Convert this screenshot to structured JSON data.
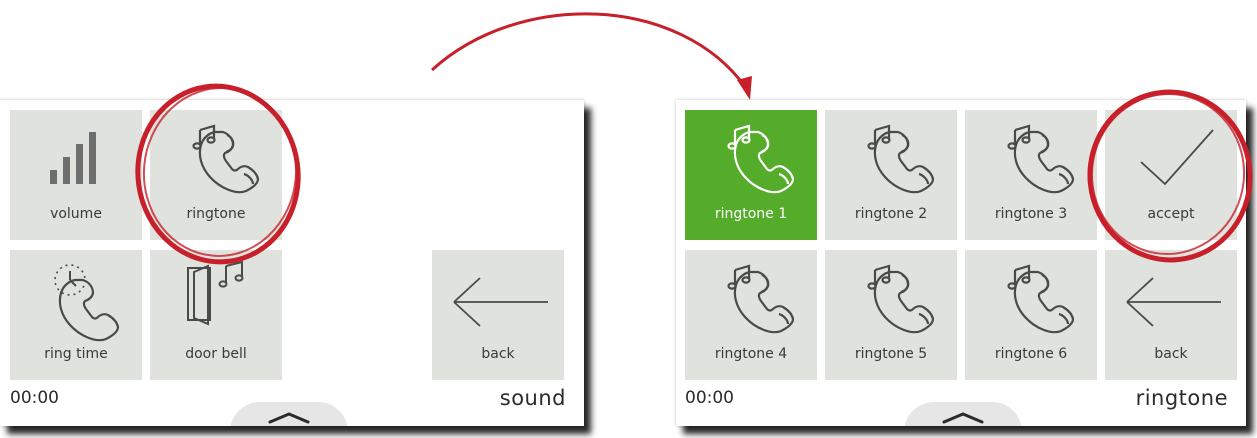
{
  "left_screen": {
    "tiles": [
      {
        "label": "volume",
        "icon": "volume-bars-icon"
      },
      {
        "label": "ringtone",
        "icon": "phone-music-icon"
      },
      {
        "label": "ring time",
        "icon": "phone-clock-icon"
      },
      {
        "label": "door bell",
        "icon": "door-music-icon"
      },
      {
        "label": "back",
        "icon": "back-arrow-icon"
      }
    ],
    "clock": "00:00",
    "title": "sound"
  },
  "right_screen": {
    "tiles": [
      {
        "label": "ringtone 1",
        "icon": "phone-music-icon",
        "selected": true
      },
      {
        "label": "ringtone 2",
        "icon": "phone-music-icon"
      },
      {
        "label": "ringtone 3",
        "icon": "phone-music-icon"
      },
      {
        "label": "accept",
        "icon": "checkmark-icon"
      },
      {
        "label": "ringtone 4",
        "icon": "phone-music-icon"
      },
      {
        "label": "ringtone 5",
        "icon": "phone-music-icon"
      },
      {
        "label": "ringtone 6",
        "icon": "phone-music-icon"
      },
      {
        "label": "back",
        "icon": "back-arrow-icon"
      }
    ],
    "clock": "00:00",
    "title": "ringtone"
  },
  "colors": {
    "tile": "#dfe2dd",
    "selected_tile": "#54ac2a",
    "highlight_circle": "#c8202a",
    "arrow": "#c8202a",
    "icon_stroke": "#4a4a4a"
  }
}
